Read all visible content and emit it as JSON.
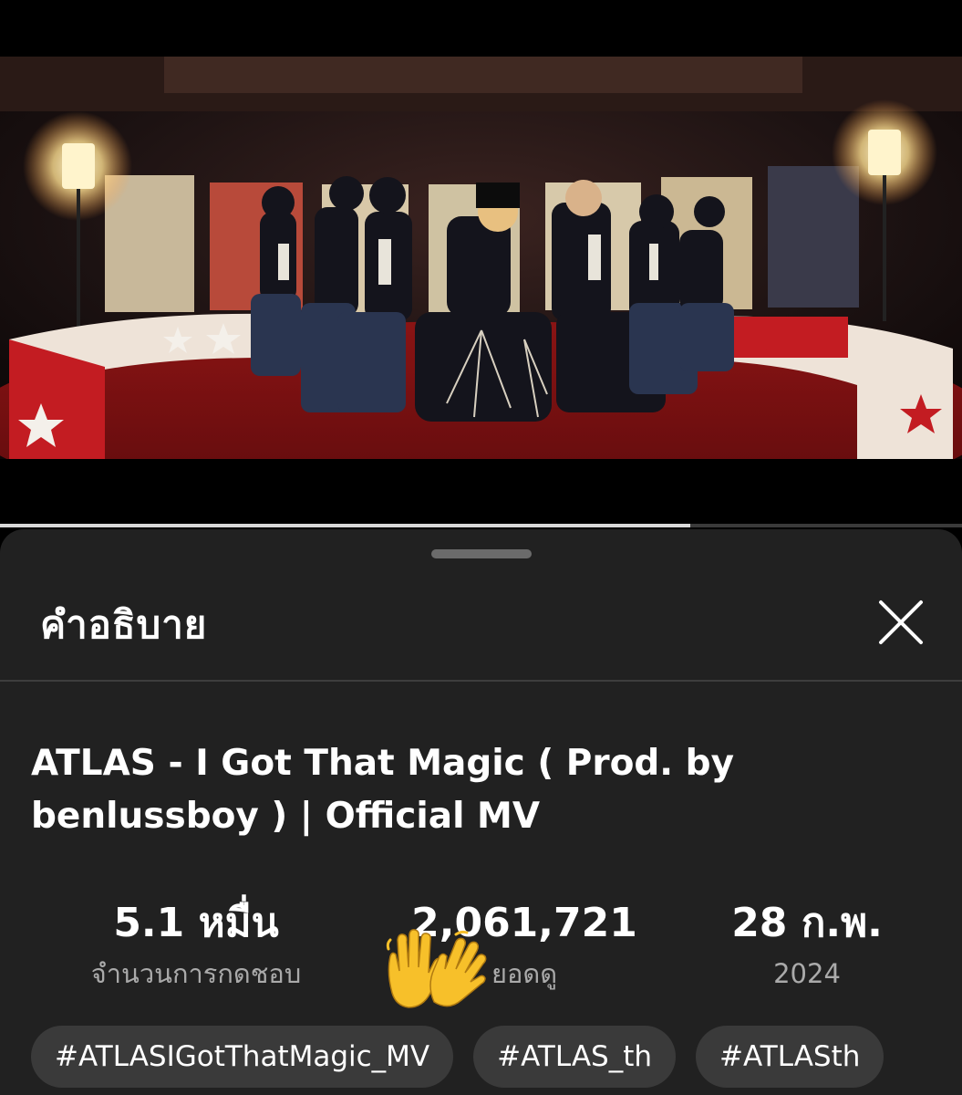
{
  "video": {
    "progress_fraction": 0.718
  },
  "sheet": {
    "title": "คำอธิบาย",
    "close_icon": "close-icon",
    "video_title": "ATLAS - I Got That Magic ( Prod. by benlussboy ) | Official MV",
    "stats": {
      "likes_value": "5.1 หมื่น",
      "likes_label": "จำนวนการกดชอบ",
      "views_value": "2,061,721",
      "views_label": "ยอดดู",
      "date_value": "28 ก.พ.",
      "date_label": "2024"
    },
    "hashtags": [
      "#ATLASIGotThatMagic_MV",
      "#ATLAS_th",
      "#ATLASth"
    ]
  }
}
